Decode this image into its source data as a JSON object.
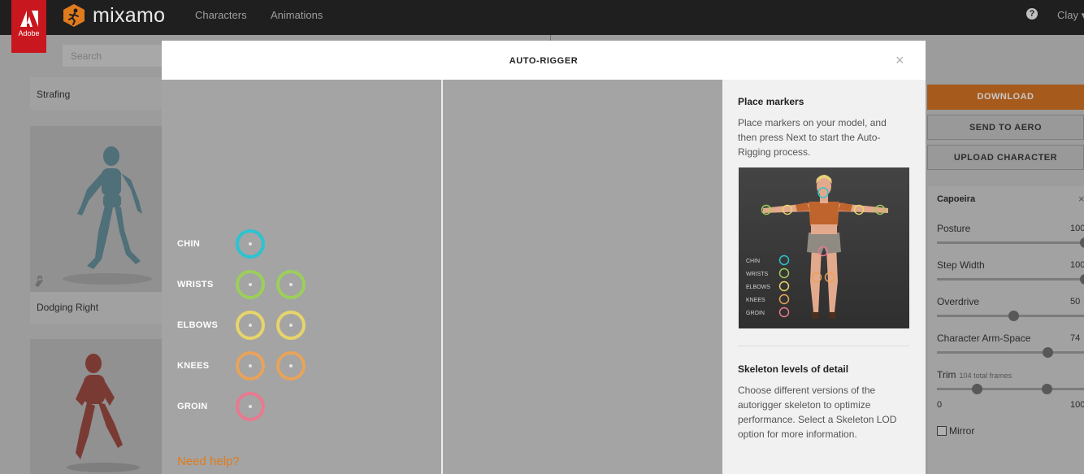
{
  "topbar": {
    "adobe_label": "Adobe",
    "brand": "mixamo",
    "nav": [
      "Characters",
      "Animations"
    ],
    "help_icon": "?",
    "user": "Clay ▾"
  },
  "library": {
    "search_placeholder": "Search",
    "cards": [
      "Strafing",
      "Dodging Right"
    ]
  },
  "actions": {
    "download": "DOWNLOAD",
    "send_to_aero": "SEND TO AERO",
    "upload_character": "UPLOAD CHARACTER"
  },
  "animation_panel": {
    "title": "Capoeira",
    "close": "×",
    "params": [
      {
        "label": "Posture",
        "value": "100",
        "level": 1.0
      },
      {
        "label": "Step Width",
        "value": "100",
        "level": 1.0
      },
      {
        "label": "Overdrive",
        "value": "50",
        "level": 0.5
      },
      {
        "label": "Character Arm-Space",
        "value": "74",
        "level": 0.74
      }
    ],
    "trim": {
      "label": "Trim",
      "frames_note": "104 total frames",
      "min": "0",
      "max": "100"
    },
    "mirror_label": "Mirror"
  },
  "modal": {
    "title": "AUTO-RIGGER",
    "close": "×",
    "markers": [
      {
        "label": "CHIN",
        "count": 1,
        "color": "#2bc4cf"
      },
      {
        "label": "WRISTS",
        "count": 2,
        "color": "#9ccf5a"
      },
      {
        "label": "ELBOWS",
        "count": 2,
        "color": "#e7d46b"
      },
      {
        "label": "KNEES",
        "count": 2,
        "color": "#e8a35a"
      },
      {
        "label": "GROIN",
        "count": 1,
        "color": "#e87a90"
      }
    ],
    "sidebar": {
      "place_heading": "Place markers",
      "place_text": "Place markers on your model, and then press Next to start the Auto-Rigging process.",
      "legend": [
        "CHIN",
        "WRISTS",
        "ELBOWS",
        "KNEES",
        "GROIN"
      ],
      "lod_heading": "Skeleton levels of detail",
      "lod_text": "Choose different versions of the autorigger skeleton to optimize performance. Select a Skeleton LOD option for more information.",
      "help_link": "Need help?"
    }
  },
  "colors": {
    "accent": "#e07b1d",
    "adobe_red": "#c8171e",
    "topbar": "#1f1f1f"
  }
}
